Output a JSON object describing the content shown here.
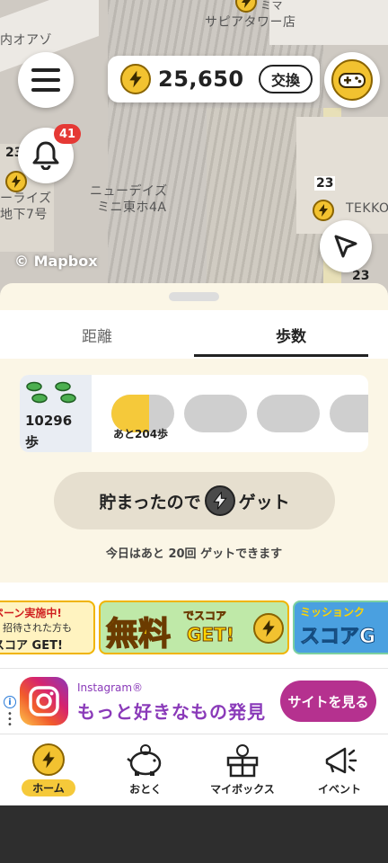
{
  "map": {
    "labels": [
      "サピアタワー店",
      "内オアゾ",
      "ニューデイズ",
      "ミニ東ホ4A",
      "ーライズ",
      "地下7号",
      "TEKKO",
      "ミマ"
    ],
    "numbers": [
      "23",
      "23",
      "23"
    ],
    "attribution": "© Mapbox"
  },
  "header": {
    "balance": "25,650",
    "exchange_label": "交換",
    "notification_count": "41"
  },
  "tabs": [
    {
      "label": "距離"
    },
    {
      "label": "歩数"
    }
  ],
  "steps": {
    "count": "10296",
    "unit": "歩",
    "first_progress": 0.6,
    "remaining_caption": "あと204歩"
  },
  "get_button": {
    "text_before": "貯まったので",
    "text_after": "ゲット"
  },
  "remaining_text": "今日はあと 20回 ゲットできます",
  "banners": [
    {
      "line1": "ペーン実施中!",
      "line2": "、招待された方も",
      "line3": "スコア GET!"
    },
    {
      "big": "無料",
      "small": "でスコア",
      "sub": "GET!"
    },
    {
      "line1": "ミッションク",
      "line2": "スコアG"
    }
  ],
  "ad": {
    "source": "Instagram®",
    "title": "もっと好きなもの発見",
    "cta": "サイトを見る"
  },
  "nav": [
    {
      "label": "ホーム"
    },
    {
      "label": "おとく"
    },
    {
      "label": "マイボックス"
    },
    {
      "label": "イベント"
    }
  ],
  "colors": {
    "accent": "#f5c93a",
    "badge": "#e53935",
    "ad_purple": "#b5318f"
  }
}
